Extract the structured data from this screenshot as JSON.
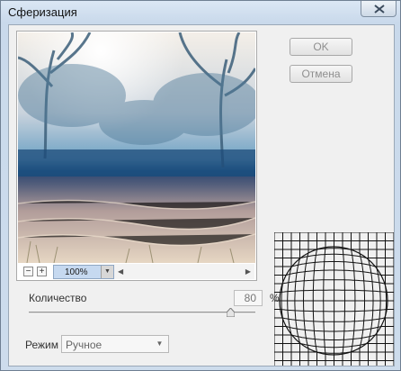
{
  "window": {
    "title": "Сферизация"
  },
  "buttons": {
    "ok": "OK",
    "cancel": "Отмена"
  },
  "preview": {
    "zoom": "100%",
    "zoom_out_symbol": "−",
    "zoom_in_symbol": "+"
  },
  "amount": {
    "label": "Количество",
    "value": "80",
    "unit": "%",
    "slider_value_percent": 80
  },
  "mode": {
    "label": "Режим",
    "selected": "Ручное"
  }
}
